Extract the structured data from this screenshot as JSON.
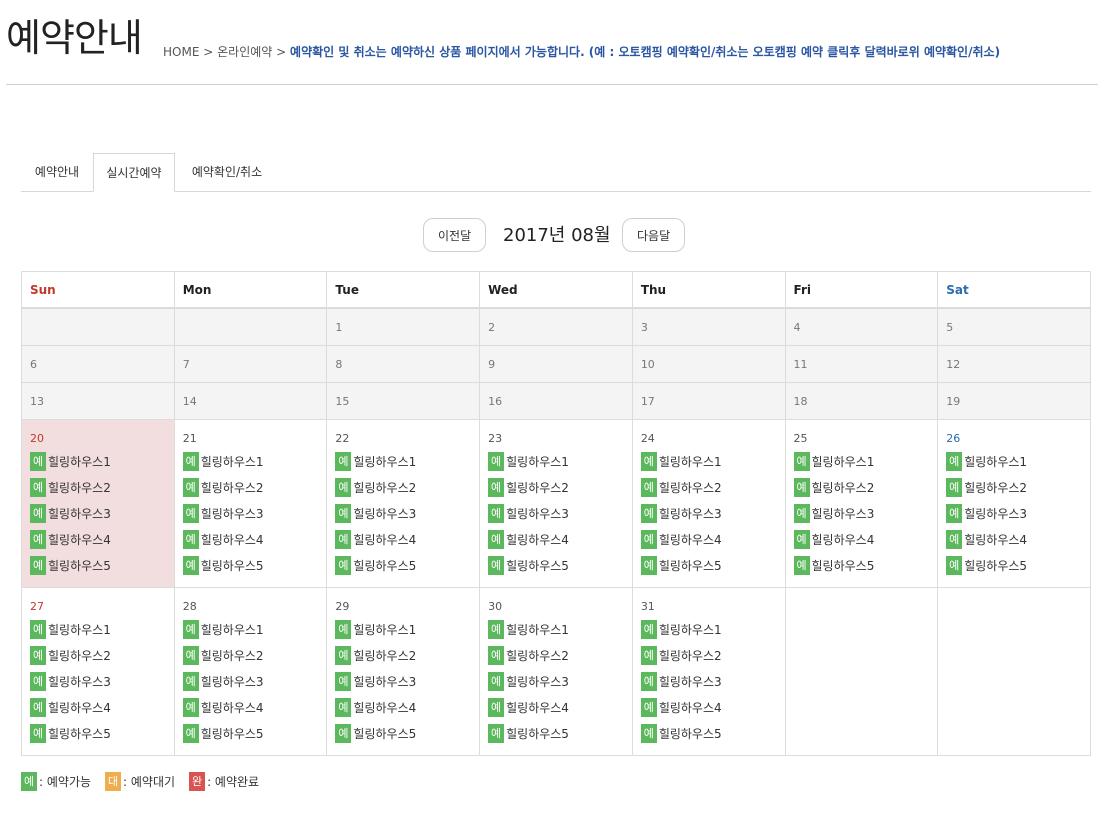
{
  "header": {
    "title": "예약안내",
    "breadcrumb_home": "HOME",
    "breadcrumb_sep": ">",
    "breadcrumb_current": "온라인예약",
    "notice": "예약확인 및 취소는 예약하신 상품 페이지에서 가능합니다. (예 : 오토캠핑 예약확인/취소는 오토캠핑 예약 클릭후 달력바로위 예약확인/취소)"
  },
  "tabs": [
    {
      "label": "예약안내",
      "active": false
    },
    {
      "label": "실시간예약",
      "active": true
    },
    {
      "label": "예약확인/취소",
      "active": false
    }
  ],
  "nav": {
    "prev_label": "이전달",
    "next_label": "다음달",
    "month_label": "2017년 08월"
  },
  "weekdays": [
    "Sun",
    "Mon",
    "Tue",
    "Wed",
    "Thu",
    "Fri",
    "Sat"
  ],
  "calendar": {
    "past_weeks": [
      [
        "",
        "",
        "1",
        "2",
        "3",
        "4",
        "5"
      ],
      [
        "6",
        "7",
        "8",
        "9",
        "10",
        "11",
        "12"
      ],
      [
        "13",
        "14",
        "15",
        "16",
        "17",
        "18",
        "19"
      ]
    ],
    "available_weeks": [
      [
        "20",
        "21",
        "22",
        "23",
        "24",
        "25",
        "26"
      ],
      [
        "27",
        "28",
        "29",
        "30",
        "31",
        "",
        ""
      ]
    ],
    "today": "20",
    "rooms": [
      "힐링하우스1",
      "힐링하우스2",
      "힐링하우스3",
      "힐링하우스4",
      "힐링하우스5"
    ],
    "status_badge": "예"
  },
  "legend": [
    {
      "badge": "예",
      "label": ": 예약가능",
      "color": "#5cb85c"
    },
    {
      "badge": "대",
      "label": ": 예약대기",
      "color": "#f0ad4e"
    },
    {
      "badge": "완",
      "label": ": 예약완료",
      "color": "#d9534f"
    }
  ]
}
